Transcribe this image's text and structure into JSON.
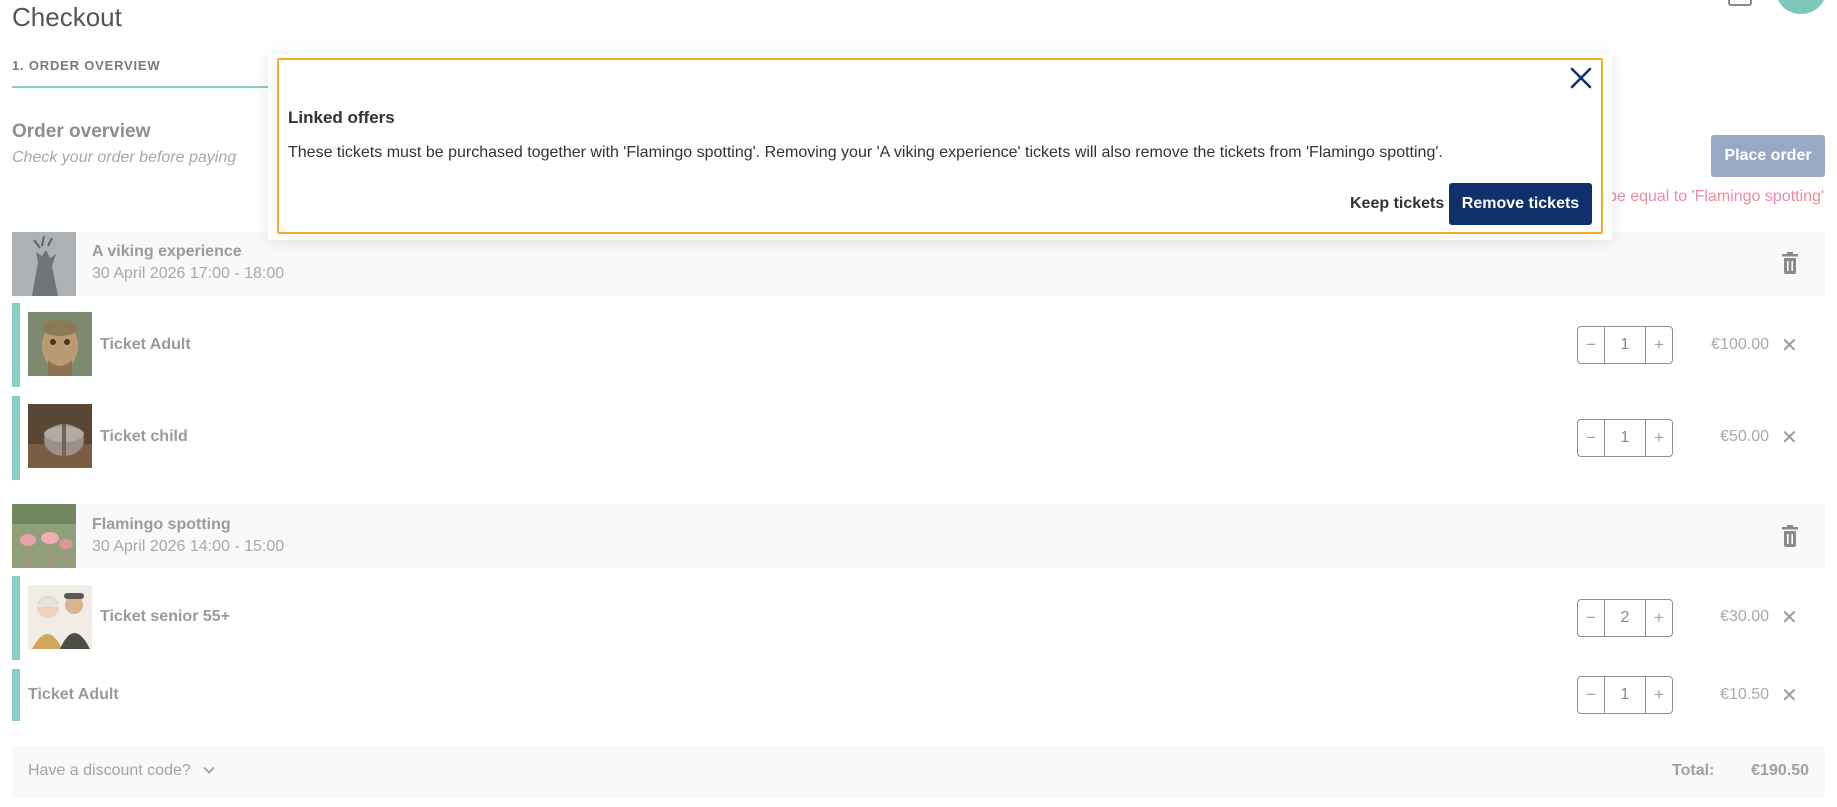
{
  "page": {
    "title": "Checkout"
  },
  "steps": {
    "active_label": "1. ORDER OVERVIEW"
  },
  "overview": {
    "title": "Order overview",
    "subtitle": "Check your order before paying",
    "place_order_label": "Place order",
    "error_text": "be equal to 'Flamingo spotting'"
  },
  "events": [
    {
      "name": "A viking experience",
      "date": "30 April 2026 17:00 - 18:00",
      "tickets": [
        {
          "name": "Ticket Adult",
          "quantity": "1",
          "price": "€100.00"
        },
        {
          "name": "Ticket child",
          "quantity": "1",
          "price": "€50.00"
        }
      ]
    },
    {
      "name": "Flamingo spotting",
      "date": "30 April 2026 14:00 - 15:00",
      "tickets": [
        {
          "name": "Ticket senior 55+",
          "quantity": "2",
          "price": "€30.00"
        },
        {
          "name": "Ticket Adult",
          "quantity": "1",
          "price": "€10.50"
        }
      ]
    }
  ],
  "stepper": {
    "minus": "−",
    "plus": "+"
  },
  "remove_glyph": "✕",
  "footer": {
    "discount_label": "Have a discount code?",
    "total_label": "Total:",
    "total_value": "€190.50"
  },
  "modal": {
    "title": "Linked offers",
    "message": "These tickets must be purchased together with 'Flamingo spotting'. Removing your 'A viking experience' tickets will also remove the tickets from 'Flamingo spotting'.",
    "keep_label": "Keep tickets",
    "remove_label": "Remove tickets"
  },
  "colors": {
    "accent_teal": "#86cfc2",
    "primary_navy": "#0f316b",
    "modal_border": "#f4ad25",
    "error_pink": "#ec8ba0",
    "place_order_disabled": "#99a8c4"
  },
  "icons": {
    "trash": "trash-icon",
    "close": "close-icon",
    "chevron": "chevron-down-icon",
    "remove": "close-icon"
  }
}
